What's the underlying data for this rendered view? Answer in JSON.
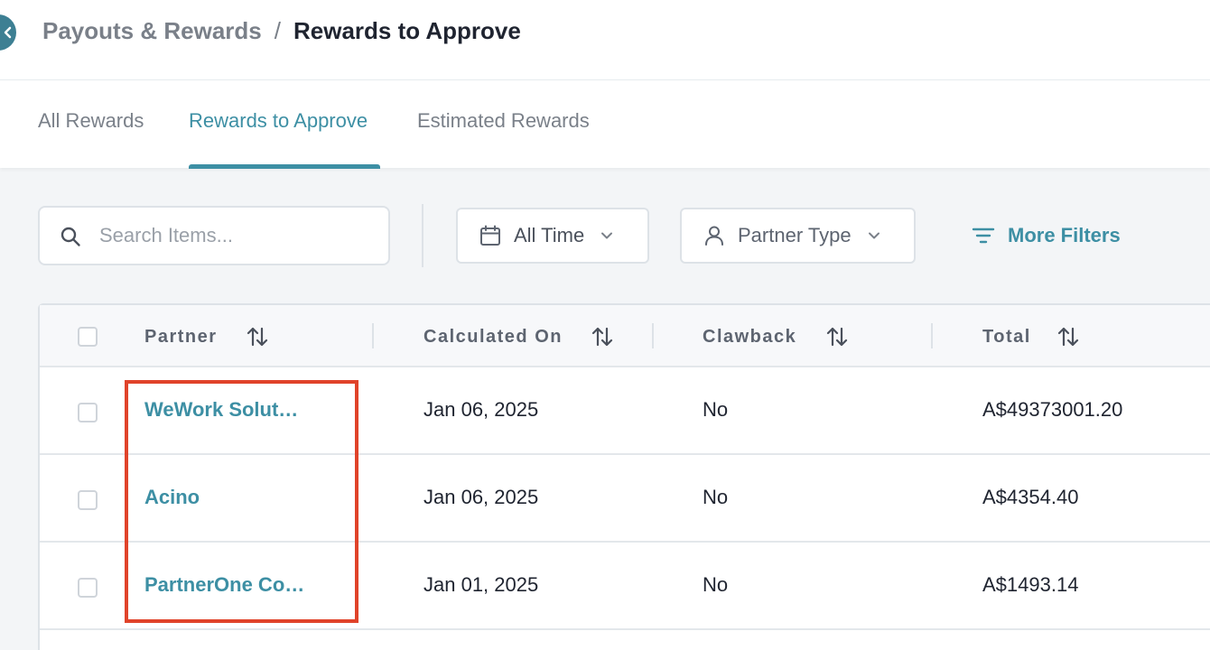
{
  "breadcrumb": {
    "parent": "Payouts & Rewards",
    "separator": "/",
    "current": "Rewards to Approve"
  },
  "tabs": [
    {
      "label": "All Rewards",
      "active": false
    },
    {
      "label": "Rewards to Approve",
      "active": true
    },
    {
      "label": "Estimated Rewards",
      "active": false
    }
  ],
  "filters": {
    "search_placeholder": "Search Items...",
    "time_label": "All Time",
    "partner_type_label": "Partner Type",
    "more_filters_label": "More Filters"
  },
  "table": {
    "columns": [
      "Partner",
      "Calculated On",
      "Clawback",
      "Total"
    ],
    "rows": [
      {
        "partner": "WeWork Solut…",
        "calculated_on": "Jan 06, 2025",
        "clawback": "No",
        "total": "A$49373001.20"
      },
      {
        "partner": "Acino",
        "calculated_on": "Jan 06, 2025",
        "clawback": "No",
        "total": "A$4354.40"
      },
      {
        "partner": "PartnerOne Co…",
        "calculated_on": "Jan 01, 2025",
        "clawback": "No",
        "total": "A$1493.14"
      }
    ]
  },
  "colors": {
    "accent": "#3d8fa4",
    "highlight": "#e0432a"
  },
  "icons": {
    "back": "chevron-left-icon",
    "search": "search-icon",
    "calendar": "calendar-icon",
    "user": "user-icon",
    "chevron": "chevron-down-icon",
    "filter": "filter-lines-icon",
    "sort": "sort-arrows-icon"
  }
}
